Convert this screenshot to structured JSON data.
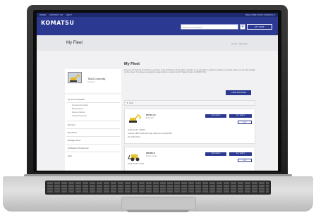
{
  "site": {
    "top_links": [
      "HOME",
      "CONTACT US",
      "HELP"
    ],
    "top_right": "WELCOME TODD CONNOLLY",
    "logo": "KOMATSU",
    "search_placeholder": "Search for machines",
    "cart_label": "MY CART"
  },
  "page": {
    "title": "My Fleet",
    "breadcrumb": "Home > My Fleet"
  },
  "profile": {
    "name": "Todd Connolly",
    "subtitle": "Customer"
  },
  "sidebar": {
    "items": [
      {
        "label": "My Account Details",
        "subitems": [
          "Personal Information",
          "Billing Address",
          "Delivery Address",
          "Change Password"
        ]
      },
      {
        "label": "My Fleet",
        "subitems": []
      },
      {
        "label": "My Orders",
        "subitems": []
      },
      {
        "label": "Manage Users",
        "subitems": []
      },
      {
        "label": "Notification Preferences",
        "subitems": []
      },
      {
        "label": "Help",
        "subitems": []
      }
    ]
  },
  "main": {
    "heading": "My Fleet",
    "description": "Here you can find a list of machines in your fleet. If you would like to add or delete a machine or you would like to update the details of a machine, please use the tools available on this screen. If you have any questions, please feel free to contact our 24/7 Support Centre on 1800 KO MA.",
    "add_button": "+ ADD MACHINE",
    "filter_label": "Filter",
    "machines": [
      {
        "model": "PC210-10",
        "type": "Excavator",
        "serial": "Serial Number: 300578",
        "location": "Location: 9999 Construction Way, Melbourne, Victoria 3000",
        "hours": "Hrs: 4,500 Hours",
        "parts_button": "VIEW PARTS",
        "extra_button": "BUY PARTS",
        "edit_button": "EDIT",
        "color": "#e6c22a"
      },
      {
        "model": "WA320-8",
        "type": "Wheel Loader",
        "serial": "Serial Number: 94437",
        "location": "",
        "hours": "",
        "parts_button": "VIEW PARTS",
        "extra_button": "BUY PARTS",
        "edit_button": "EDIT",
        "color": "#e6c22a"
      }
    ]
  }
}
